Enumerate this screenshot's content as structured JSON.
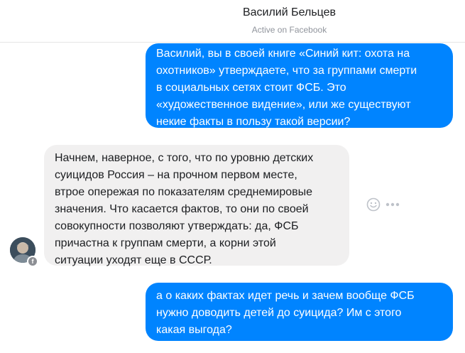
{
  "header": {
    "contact_name": "Василий Бельцев",
    "status": "Active on Facebook"
  },
  "messages": [
    {
      "direction": "outgoing",
      "lines": [
        "Василий, вы в своей книге «Синий кит: охота на",
        "охотников» утверждаете, что за группами смерти",
        "в социальных сетях стоит ФСБ. Это",
        "«художественное видение», или же существуют",
        "некие факты в пользу такой версии?"
      ]
    },
    {
      "direction": "incoming",
      "lines": [
        "Начнем, наверное, с того, что по уровню детских",
        "суицидов Россия – на прочном первом месте,",
        "втрое опережая по показателям среднемировые",
        "значения. Что касается фактов, то они по своей",
        "совокупности позволяют утверждать: да, ФСБ",
        "причастна к группам смерти, а корни этой",
        "ситуации уходят еще в СССР."
      ]
    },
    {
      "direction": "outgoing",
      "lines": [
        "а о каких фактах идет речь и зачем вообще ФСБ",
        "нужно доводить детей до суицида? Им с этого",
        "какая выгода?"
      ]
    }
  ],
  "message_actions": {
    "react_icon": "smiley-icon",
    "more_icon": "more-options-icon"
  },
  "avatar_badge": {
    "icon": "facebook-badge-icon",
    "glyph": "f"
  },
  "colors": {
    "outgoing_bubble": "#0084ff",
    "incoming_bubble": "#f1f0f0",
    "header_status": "#90949c"
  }
}
